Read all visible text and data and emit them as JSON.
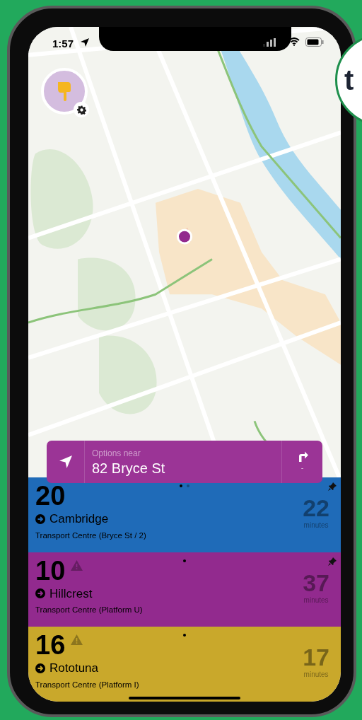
{
  "status_bar": {
    "time": "1:57"
  },
  "side_logo": {
    "text": "t"
  },
  "location_bar": {
    "label": "Options near",
    "address": "82 Bryce St",
    "directions_value": "-"
  },
  "departures": [
    {
      "route": "20",
      "destination": "Cambridge",
      "stop": "Transport Centre (Bryce St / 2)",
      "minutes": "22",
      "minutes_label": "minutes",
      "color": "#1f6bb8",
      "alert": false,
      "pinned": true,
      "pages": [
        {
          "selected": true
        },
        {
          "selected": false
        }
      ]
    },
    {
      "route": "10",
      "destination": "Hillcrest",
      "stop": "Transport Centre (Platform U)",
      "minutes": "37",
      "minutes_label": "minutes",
      "color": "#922a8e",
      "alert": true,
      "pinned": true,
      "pages": [
        {
          "selected": true
        }
      ]
    },
    {
      "route": "16",
      "destination": "Rototuna",
      "stop": "Transport Centre (Platform I)",
      "minutes": "17",
      "minutes_label": "minutes",
      "color": "#c9a82b",
      "alert": true,
      "pinned": false,
      "pages": [
        {
          "selected": true
        }
      ]
    }
  ]
}
